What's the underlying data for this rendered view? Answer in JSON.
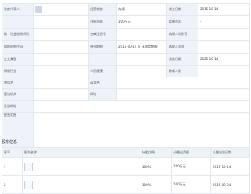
{
  "company_info": {
    "rows": [
      {
        "cells": [
          {
            "text": "法定代表人",
            "type": "label"
          },
          {
            "text": "",
            "type": "value"
          },
          {
            "text": "经营状态",
            "type": "label"
          },
          {
            "text": "存续",
            "type": "value"
          },
          {
            "text": "成立日期",
            "type": "label"
          },
          {
            "text": "2015-10-14",
            "type": "value"
          }
        ]
      },
      {
        "cells": [
          {
            "text": "",
            "type": "label"
          },
          {
            "text": "",
            "type": "value"
          },
          {
            "text": "注册资本",
            "type": "label"
          },
          {
            "text": "100万元",
            "type": "value"
          },
          {
            "text": "实缴资本",
            "type": "label"
          },
          {
            "text": "-",
            "type": "value"
          }
        ]
      },
      {
        "cells": [
          {
            "text": "统一社会信用代码",
            "type": "label"
          },
          {
            "text": "",
            "type": "value"
          },
          {
            "text": "工商注册号",
            "type": "label"
          },
          {
            "text": "",
            "type": "value"
          },
          {
            "text": "纳税人识别号",
            "type": "label"
          },
          {
            "text": "",
            "type": "value"
          }
        ]
      },
      {
        "cells": [
          {
            "text": "组织机构代码",
            "type": "label"
          },
          {
            "text": "",
            "type": "value"
          },
          {
            "text": "营业期限",
            "type": "label"
          },
          {
            "text": "2015-10-14 至 无固定期限",
            "type": "value"
          },
          {
            "text": "纳税人资质",
            "type": "label"
          },
          {
            "text": "",
            "type": "value"
          }
        ]
      },
      {
        "cells": [
          {
            "text": "企业类型",
            "type": "label"
          },
          {
            "text": "",
            "type": "value"
          },
          {
            "text": "",
            "type": "label"
          },
          {
            "text": "",
            "type": "value"
          },
          {
            "text": "核准日期",
            "type": "label"
          },
          {
            "text": "2025-10-14",
            "type": "value"
          }
        ]
      },
      {
        "cells": [
          {
            "text": "所属行业",
            "type": "label"
          },
          {
            "text": "",
            "type": "value"
          },
          {
            "text": "人员规模",
            "type": "label"
          },
          {
            "text": "",
            "type": "value"
          },
          {
            "text": "参保人数",
            "type": "label"
          },
          {
            "text": "",
            "type": "value"
          }
        ]
      },
      {
        "cells": [
          {
            "text": "曾用名",
            "type": "label"
          },
          {
            "text": "",
            "type": "value"
          },
          {
            "text": "英文名",
            "type": "label"
          },
          {
            "text": "",
            "type": "value"
          }
        ]
      },
      {
        "cells": [
          {
            "text": "登记机关",
            "type": "label"
          },
          {
            "text": "",
            "type": "value"
          },
          {
            "text": "网址",
            "type": "label"
          },
          {
            "text": "",
            "type": "value"
          }
        ]
      },
      {
        "cells": [
          {
            "text": "注册地址",
            "type": "label"
          },
          {
            "text": "",
            "type": "value"
          },
          {
            "text": "",
            "type": "label"
          },
          {
            "text": "",
            "type": "value"
          }
        ]
      }
    ],
    "scope_label": "经营范围",
    "scope_text": ""
  },
  "investors": {
    "title": "股东信息",
    "columns": [
      "序号",
      "股东名称",
      "持股比例",
      "认缴出资额",
      "认缴出资日期"
    ],
    "rows": [
      {
        "index": "1",
        "name": "",
        "ratio": "100%",
        "amount": "100万元",
        "date": "2015-10-14"
      },
      {
        "index": "2",
        "name": "",
        "ratio": "100%",
        "amount": "100万元",
        "date": "2015-09-04"
      }
    ]
  },
  "colors": {
    "label_bg": "#eef3fa",
    "border": "#e3e8ef",
    "link": "#2b6fd1"
  }
}
